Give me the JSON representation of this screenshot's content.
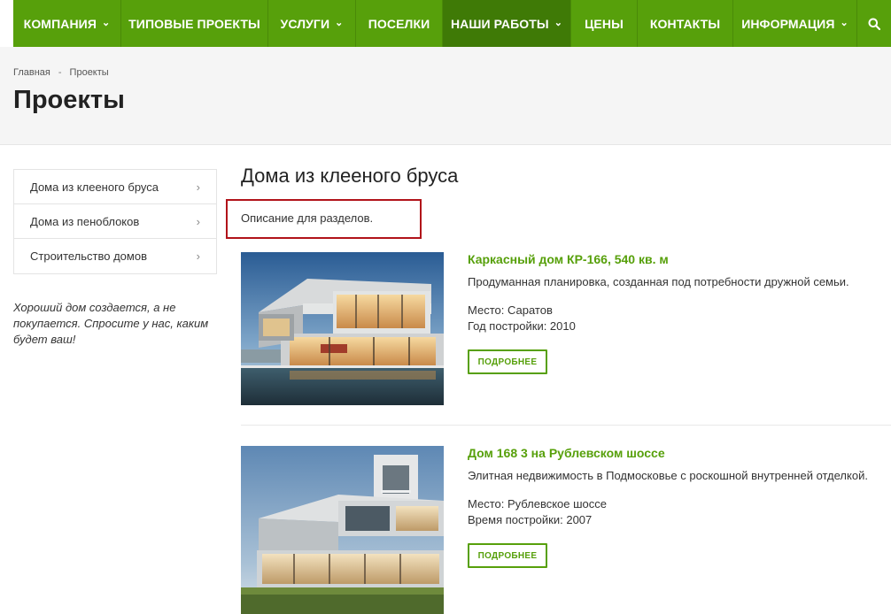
{
  "nav": {
    "items": [
      {
        "label": "КОМПАНИЯ",
        "dropdown": true
      },
      {
        "label": "ТИПОВЫЕ ПРОЕКТЫ",
        "dropdown": false
      },
      {
        "label": "УСЛУГИ",
        "dropdown": true
      },
      {
        "label": "ПОСЕЛКИ",
        "dropdown": false
      },
      {
        "label": "НАШИ РАБОТЫ",
        "dropdown": true,
        "active": true
      },
      {
        "label": "ЦЕНЫ",
        "dropdown": false
      },
      {
        "label": "КОНТАКТЫ",
        "dropdown": false
      },
      {
        "label": "ИНФОРМАЦИЯ",
        "dropdown": true
      }
    ],
    "search_icon": "search-icon"
  },
  "breadcrumb": {
    "home": "Главная",
    "separator": "-",
    "current": "Проекты"
  },
  "page_title": "Проекты",
  "sidebar": {
    "items": [
      {
        "label": "Дома из клееного бруса"
      },
      {
        "label": "Дома из пеноблоков"
      },
      {
        "label": "Строительство домов"
      }
    ],
    "quote": "Хороший дом создается, а не покупается. Спросите у нас, каким будет ваш!"
  },
  "section": {
    "title": "Дома из клееного бруса",
    "description": "Описание для разделов."
  },
  "projects": [
    {
      "title": "Каркасный дом КР-166, 540 кв. м",
      "description": "Продуманная планировка, созданная под потребности дружной семьи.",
      "place": "Место: Саратов",
      "year": "Год постройки: 2010",
      "button": "ПОДРОБНЕЕ"
    },
    {
      "title": "Дом 168 3 на Рублевском шоссе",
      "description": "Элитная недвижимость в Подмосковье с роскошной внутренней отделкой.",
      "place": "Место: Рублевское шоссе",
      "year": "Время постройки: 2007",
      "button": "ПОДРОБНЕЕ"
    }
  ],
  "colors": {
    "brand": "#57a00b",
    "brand_dark": "#3f7a06",
    "highlight_border": "#b1131a"
  }
}
